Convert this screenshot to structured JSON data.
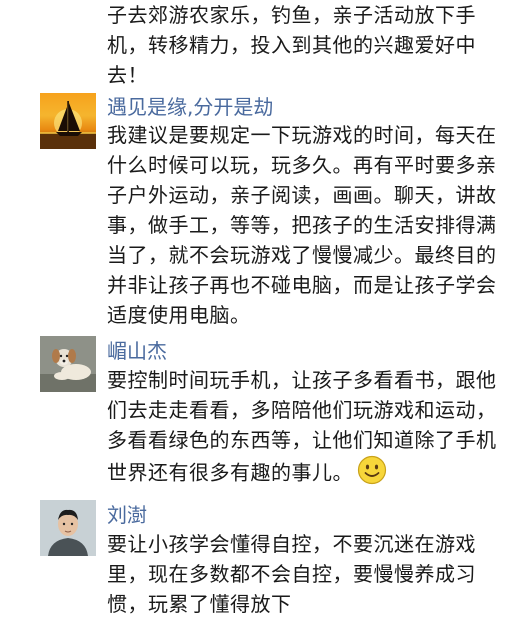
{
  "thread": {
    "continued_comment": {
      "text": "子去郊游农家乐，钓鱼，亲子活动放下手机，转移精力，投入到其他的兴趣爱好中去！"
    },
    "comments": [
      {
        "username": "遇见是缘,分开是劫",
        "avatar_icon": "sunset-sailboat-avatar",
        "text": "我建议是要规定一下玩游戏的时间，每天在什么时候可以玩，玩多久。再有平时要多亲子户外运动，亲子阅读，画画。聊天，讲故事，做手工，等等，把孩子的生活安排得满当了，就不会玩游戏了慢慢减少。最终目的并非让孩子再也不碰电脑，而是让孩子学会适度使用电脑。"
      },
      {
        "username": "嵋山杰",
        "avatar_icon": "dog-avatar",
        "text": "要控制时间玩手机，让孩子多看看书，跟他们去走走看看，多陪陪他们玩游戏和运动，多看看绿色的东西等，让他们知道除了手机世界还有很多有趣的事儿。",
        "emoji_icon": "smiley-face-icon"
      },
      {
        "username": "刘澍",
        "avatar_icon": "person-avatar",
        "text": "要让小孩学会懂得自控，不要沉迷在游戏里，现在多数都不会自控，要慢慢养成习惯，玩累了懂得放下"
      }
    ]
  },
  "colors": {
    "username": "#4a6a9e",
    "text": "#1a1a1a",
    "background": "#ffffff"
  }
}
